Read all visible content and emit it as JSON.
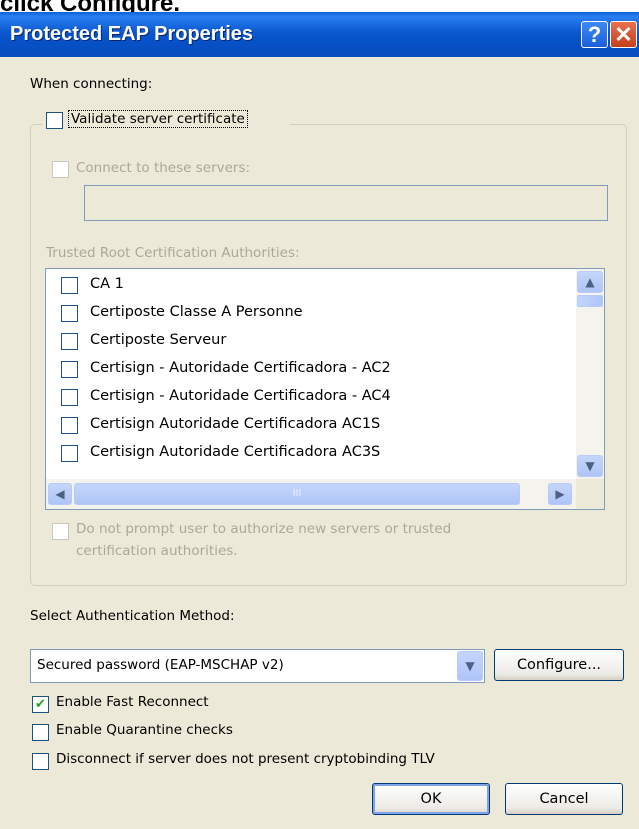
{
  "caption": "click Configure.",
  "window": {
    "title": "Protected EAP Properties",
    "help_glyph": "?",
    "close_glyph": "✕"
  },
  "when_connecting_label": "When connecting:",
  "validate_cert": {
    "label": "Validate server certificate",
    "checked": false
  },
  "connect_servers": {
    "label": "Connect to these servers:",
    "checked": false,
    "value": ""
  },
  "trusted_label": "Trusted Root Certification Authorities:",
  "authorities": [
    {
      "label": "CA 1",
      "checked": false
    },
    {
      "label": "Certiposte Classe A Personne",
      "checked": false
    },
    {
      "label": "Certiposte Serveur",
      "checked": false
    },
    {
      "label": "Certisign - Autoridade Certificadora - AC2",
      "checked": false
    },
    {
      "label": "Certisign - Autoridade Certificadora - AC4",
      "checked": false
    },
    {
      "label": "Certisign Autoridade Certificadora AC1S",
      "checked": false
    },
    {
      "label": "Certisign Autoridade Certificadora AC3S",
      "checked": false
    }
  ],
  "do_not_prompt": {
    "line1": "Do not prompt user to authorize new servers or trusted",
    "line2": "certification authorities.",
    "checked": false
  },
  "select_method_label": "Select Authentication Method:",
  "method_value": "Secured password (EAP-MSCHAP v2)",
  "configure_button": "Configure...",
  "options": {
    "fast_reconnect": {
      "label": "Enable Fast Reconnect",
      "checked": true
    },
    "quarantine": {
      "label": "Enable Quarantine checks",
      "checked": false
    },
    "cryptobinding": {
      "label": "Disconnect if server does not present cryptobinding TLV",
      "checked": false
    }
  },
  "ok_button": "OK",
  "cancel_button": "Cancel",
  "scroll_glyphs": {
    "up": "▲",
    "down": "▼",
    "left": "◀",
    "right": "▶",
    "grip": "III"
  }
}
